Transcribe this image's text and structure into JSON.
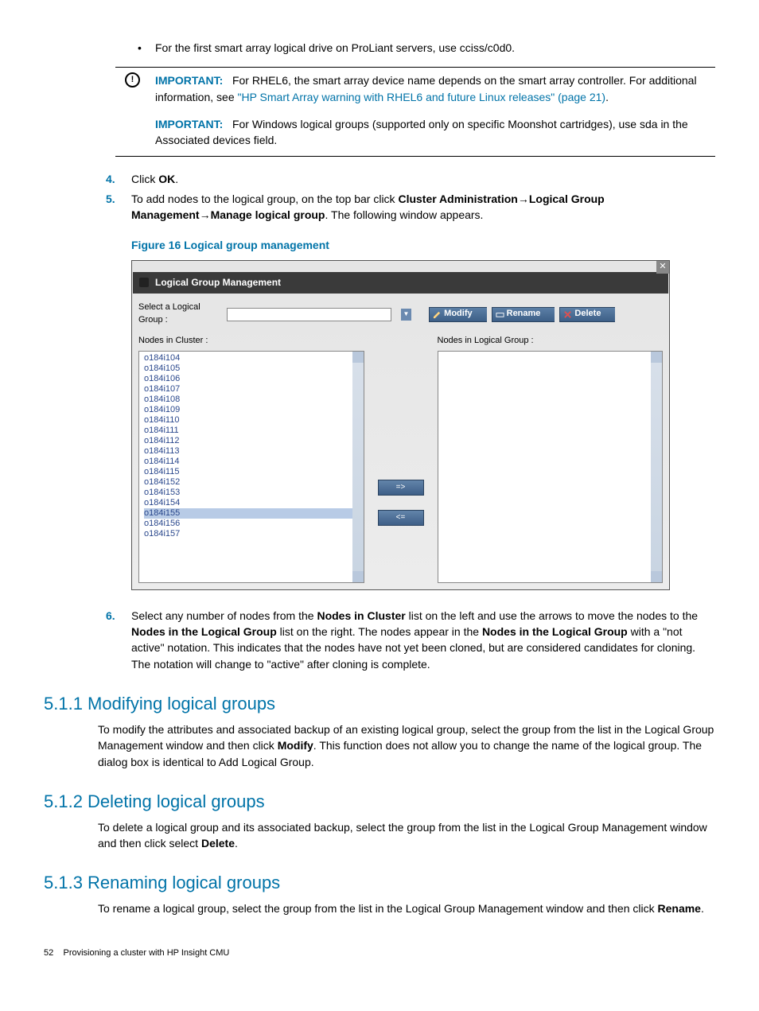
{
  "bullet1": "For the first smart array logical drive on ProLiant servers, use cciss/c0d0.",
  "important1": {
    "label": "IMPORTANT:",
    "t1": "For RHEL6, the smart array device name depends on the smart array controller. For additional information, see ",
    "link": "\"HP Smart Array warning with RHEL6 and future Linux releases\" (page 21)",
    "t2": "."
  },
  "important2": {
    "label": "IMPORTANT:",
    "text": "For Windows logical groups (supported only on specific Moonshot cartridges), use sda in the Associated devices field."
  },
  "steps": {
    "n4": "4.",
    "s4a": "Click ",
    "s4b": "OK",
    "s4c": ".",
    "n5": "5.",
    "s5a": "To add nodes to the logical group, on the top bar click ",
    "s5b": "Cluster Administration",
    "s5arrow": "→",
    "s5c": "Logical Group Management",
    "s5d": "Manage logical group",
    "s5e": ". The following window appears."
  },
  "figcap": "Figure 16 Logical group management",
  "panel": {
    "title": "Logical Group Management",
    "selLabel": "Select a Logical Group :",
    "modify": "Modify",
    "rename": "Rename",
    "delete": "Delete",
    "leftHead": "Nodes in Cluster :",
    "rightHead": "Nodes in Logical Group :",
    "arrR": "=>",
    "arrL": "<=",
    "nodes": [
      "o184i104",
      "o184i105",
      "o184i106",
      "o184i107",
      "o184i108",
      "o184i109",
      "o184i110",
      "o184i111",
      "o184i112",
      "o184i113",
      "o184i114",
      "o184i115",
      "o184i152",
      "o184i153",
      "o184i154",
      "o184i155",
      "o184i156",
      "o184i157"
    ]
  },
  "step6": {
    "n": "6.",
    "a": "Select any number of nodes from the ",
    "b": "Nodes in Cluster",
    "c": " list on the left and use the arrows to move the nodes to the ",
    "d": "Nodes in the Logical Group",
    "e": " list on the right. The nodes appear in the ",
    "f": "Nodes in the Logical Group",
    "g": " with a \"not active\" notation. This indicates that the nodes have not yet been cloned, but are considered candidates for cloning. The notation will change to \"active\" after cloning is complete."
  },
  "s511": {
    "h": "5.1.1 Modifying logical groups",
    "a": "To modify the attributes and associated backup of an existing logical group, select the group from the list in the Logical Group Management window and then click ",
    "b": "Modify",
    "c": ". This function does not allow you to change the name of the logical group. The dialog box is identical to Add Logical Group."
  },
  "s512": {
    "h": "5.1.2 Deleting logical groups",
    "a": "To delete a logical group and its associated backup, select the group from the list in the Logical Group Management window and then click select ",
    "b": "Delete",
    "c": "."
  },
  "s513": {
    "h": "5.1.3 Renaming logical groups",
    "a": "To rename a logical group, select the group from the list in the Logical Group Management window and then click ",
    "b": "Rename",
    "c": "."
  },
  "footer": {
    "page": "52",
    "title": "Provisioning a cluster with HP Insight CMU"
  }
}
